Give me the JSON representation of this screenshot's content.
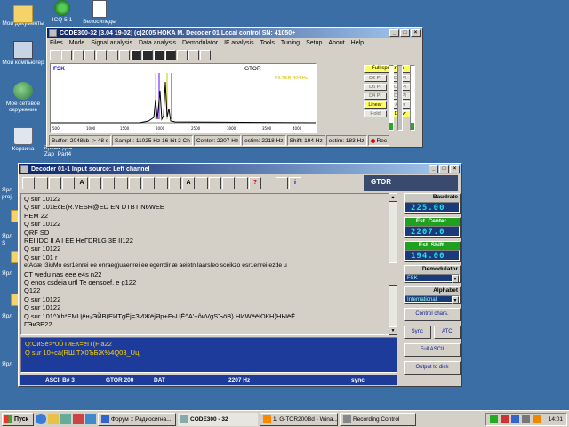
{
  "desktop": {
    "icons": [
      {
        "label": "Мои документы",
        "icon": "folder-icon"
      },
      {
        "label": "Мой компьютер",
        "icon": "computer-icon"
      },
      {
        "label": "Мое сетевое окружение",
        "icon": "network-icon"
      },
      {
        "label": "Корзина",
        "icon": "recycle-bin-icon"
      },
      {
        "label": "ICQ 5.1",
        "icon": "icq-icon"
      },
      {
        "label": "Велосипеды",
        "icon": "document-icon"
      },
      {
        "label": "Ярлык для Zap_Part4",
        "icon": "shortcut-icon"
      }
    ],
    "truncated_labels": [
      "Ярл",
      "proj",
      "Ярл",
      "S",
      "Ярл",
      "Ярл",
      "Ярл"
    ]
  },
  "code300": {
    "title": "CODE300-32 [3.04 19-02] (c)2005 HOKA M.  Decoder 01    Local control   SN: 41050+",
    "menu": [
      "Files",
      "Mode",
      "Signal analysis",
      "Data analysis",
      "Demodulator",
      "IF analysis",
      "Tools",
      "Tuning",
      "Setup",
      "About",
      "Help"
    ],
    "spectrum": {
      "fsk_label": "FSK",
      "mode_label": "GTOR",
      "filter_label": "FILTER 404 Hz"
    },
    "buttons": {
      "full_spectrum": "Full spectrum",
      "grid": [
        "D2 PI",
        "D4 PI",
        "D6 PI",
        "D8 PI",
        "D4 PI",
        "D8 PI",
        "Linear",
        "Aver",
        "Hold",
        "Draw"
      ]
    },
    "status": {
      "buffer": "Buffer: 2048kb -> 48 s",
      "sampling": "Sampl.: 11025 Hz 16-bit 2 Ch",
      "center": "Center: 2207 Hz",
      "estim1": "estim: 2218 Hz",
      "shift": "Shift: 194 Hz",
      "estim2": "estim: 183 Hz",
      "rec": "Rec"
    }
  },
  "decoder": {
    "title": "Decoder 01-1      Input source: Left channel",
    "toolbar_letters": [
      "A",
      "A"
    ],
    "mode_panel": "GTOR",
    "text_lines": [
      "Q sur 10122",
      "Q sur 101EcE(R.VESR@ED EN  DTBT  N6WEE",
      "HEM 22",
      "Q sur 10122",
      "QRF SD",
      "REI IDC II A I EE HeГDRLG 3E II122",
      "Q sur 10122",
      "Q sur 101  r i",
      " etAoæ I3iuMo esr1enrei ee enraeg)uaenrei ee egerrdir æ  aeietn   laarsleo sceikzo esr1enrei ezde u",
      "CT wedu nas eee e4s n22",
      "Q enos csdeia urtl  Te oensoef. e  g122",
      "Q122",
      "Q sur 10122",
      "Q sur 10122",
      "Q sur 101^Xh*EMЦён₃ЭЙВ(ЕИТgЁj=ЗИЖёјЯр+ЕьЦЁ^А'+ôиVgSЪöВ) НИWёёЮКН)НЫёЁ",
      "ГЭиЗЕ22"
    ],
    "input_lines": [
      "Q:CиSe>*0ÜТиЕК=ёIТ(Fiä22",
      "Q sur 10+сä(RШ.ТX0ЪБЖ%4Q03_Uц"
    ],
    "status": {
      "ascii": "ASCII B# 3",
      "mode": "GTOR 200",
      "dat": "DAT",
      "freq": "2207 Hz",
      "sync": "sync"
    },
    "panel": {
      "baudrate": {
        "label": "Baudrate",
        "value": "225.00"
      },
      "est_center": {
        "label": "Est. Center",
        "value": "2207.0"
      },
      "est_shift": {
        "label": "Est. Shift",
        "value": "194.00"
      },
      "demodulator": {
        "label": "Demodulator",
        "value": "FSK"
      },
      "alphabet": {
        "label": "Alphabet",
        "value": "International"
      },
      "buttons": {
        "control_chars": "Control chars.",
        "sync": "Sync",
        "atc": "ATC",
        "full_ascii": "Full ASCII",
        "output_disk": "Output to disk"
      }
    }
  },
  "taskbar": {
    "start": "Пуск",
    "tasks": [
      {
        "label": "Форум :: Радиосигна..."
      },
      {
        "label": "CODE300 - 32"
      },
      {
        "label": "1. G-TOR200Bd - Wina..."
      },
      {
        "label": "Recording Control"
      }
    ],
    "clock": "14:01"
  }
}
